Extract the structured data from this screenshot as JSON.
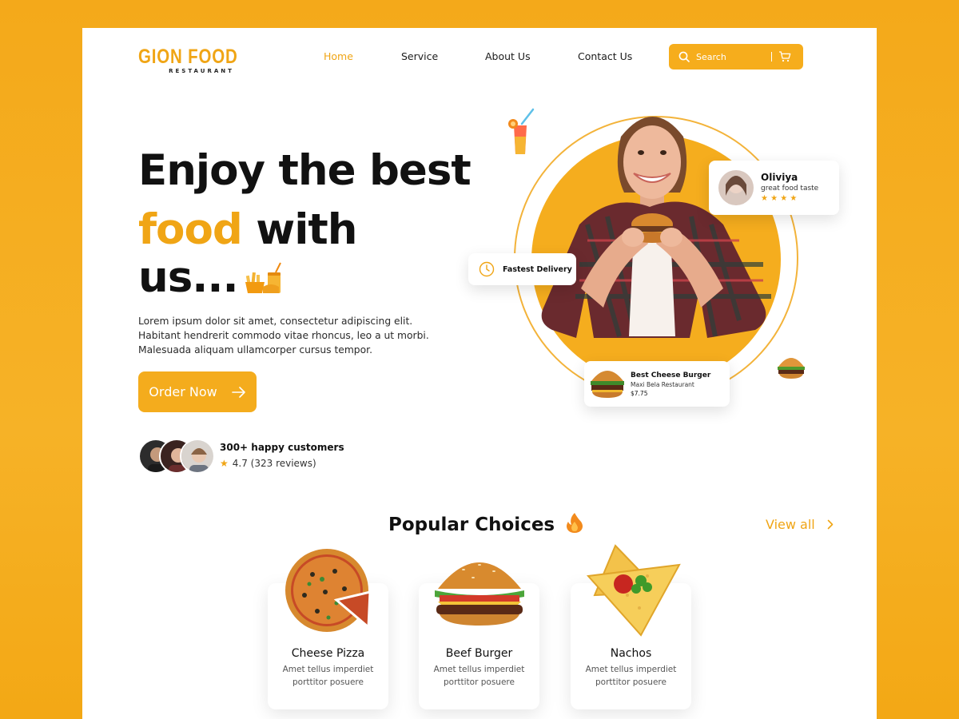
{
  "brand": {
    "name": "GION FOOD",
    "tagline": "RESTAURANT",
    "accent": "#f0a515"
  },
  "nav": {
    "items": [
      {
        "label": "Home",
        "active": true
      },
      {
        "label": "Service",
        "active": false
      },
      {
        "label": "About Us",
        "active": false
      },
      {
        "label": "Contact Us",
        "active": false
      }
    ]
  },
  "search": {
    "placeholder": "Search",
    "icon": "search-icon",
    "cart_icon": "cart-icon"
  },
  "hero": {
    "line1": "Enjoy the best",
    "line2_highlight": "food",
    "line2_rest": "with",
    "line3": "us...",
    "description": "Lorem ipsum dolor sit amet, consectetur adipiscing elit. Habitant hendrerit commodo vitae rhoncus, leo a ut morbi. Malesuada aliquam ullamcorper cursus tempor.",
    "cta": "Order Now"
  },
  "customers": {
    "title": "300+ happy customers",
    "rating": "4.7 (323 reviews)"
  },
  "review_card": {
    "name": "Oliviya",
    "text": "great food taste",
    "stars": "★ ★ ★ ★"
  },
  "delivery_card": {
    "label": "Fastest Delivery"
  },
  "product_card": {
    "name": "Best Cheese Burger",
    "restaurant": "Maxi Bela Restaurant",
    "price": "$7.75"
  },
  "popular": {
    "title": "Popular Choices",
    "view_all": "View all",
    "items": [
      {
        "name": "Cheese Pizza",
        "desc": "Amet tellus imperdiet porttitor posuere"
      },
      {
        "name": "Beef Burger",
        "desc": "Amet tellus imperdiet porttitor posuere"
      },
      {
        "name": "Nachos",
        "desc": "Amet tellus imperdiet porttitor posuere"
      }
    ]
  }
}
